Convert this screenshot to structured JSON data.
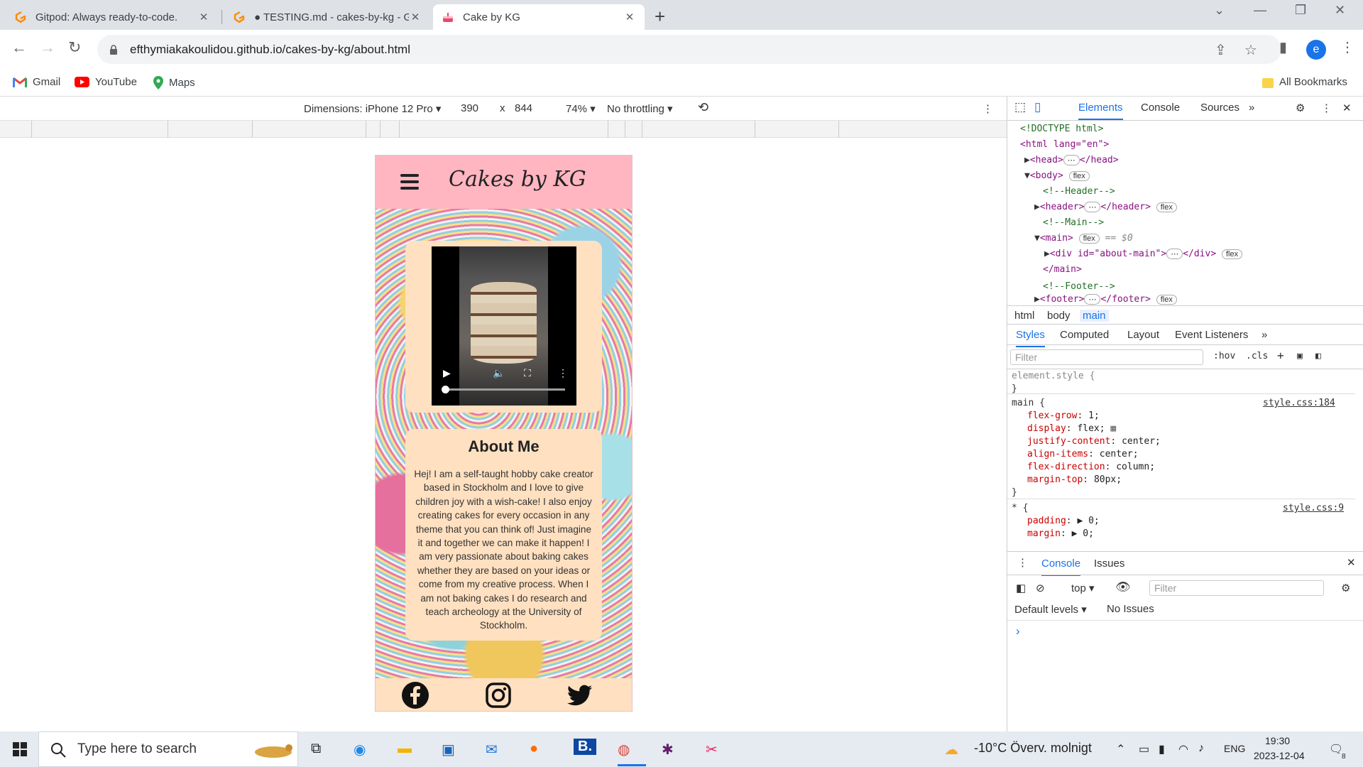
{
  "browser": {
    "tabs": [
      {
        "title": "Gitpod: Always ready-to-code.",
        "icon": "gitpod-icon"
      },
      {
        "title": "● TESTING.md - cakes-by-kg - G",
        "icon": "gitpod-icon"
      },
      {
        "title": "Cake by KG",
        "icon": "cake-favicon"
      }
    ],
    "url": "efthymiakakoulidou.github.io/cakes-by-kg/about.html",
    "profile_initial": "e",
    "bookmarks": [
      {
        "label": "Gmail",
        "icon": "gmail-icon"
      },
      {
        "label": "YouTube",
        "icon": "youtube-icon"
      },
      {
        "label": "Maps",
        "icon": "maps-icon"
      }
    ],
    "all_bookmarks": "All Bookmarks"
  },
  "device_toolbar": {
    "dimensions": "Dimensions: iPhone 12 Pro",
    "width": "390",
    "x": "x",
    "height": "844",
    "zoom": "74%",
    "throttling": "No throttling"
  },
  "site": {
    "brand": "Cakes by KG",
    "about_title": "About Me",
    "about_text": "Hej! I am a self-taught hobby cake creator based in Stockholm and I love to give children joy with a wish-cake! I also enjoy creating cakes for every occasion in any theme that you can think of! Just imagine it and together we can make it happen! I am very passionate about baking cakes whether they are based on your ideas or come from my creative process. When I am not baking cakes I do research and teach archeology at the University of Stockholm."
  },
  "devtools": {
    "tabs": [
      "Elements",
      "Console",
      "Sources"
    ],
    "dom": {
      "doctype": "<!DOCTYPE html>",
      "html_open": "<html lang=\"en\">",
      "head": "<head>",
      "head_close": "</head>",
      "body": "<body>",
      "cmt_header": "<!--Header-->",
      "header": "<header>",
      "header_close": "</header>",
      "cmt_main": "<!--Main-->",
      "main": "<main>",
      "eq": "== $0",
      "div_open": "<div id=\"about-main\">",
      "div_close": "</div>",
      "main_close": "</main>",
      "cmt_footer": "<!--Footer-->",
      "footer": "<footer>",
      "footer_close": "</footer>",
      "flex": "flex",
      "ellipsis": "⋯"
    },
    "breadcrumbs": [
      "html",
      "body",
      "main"
    ],
    "subtabs": [
      "Styles",
      "Computed",
      "Layout",
      "Event Listeners"
    ],
    "filter_placeholder": "Filter",
    "hov": ":hov",
    "cls": ".cls",
    "styles": {
      "element_style": "element.style {",
      "close": "}",
      "main_selector": "main {",
      "main_source": "style.css:184",
      "props": [
        {
          "name": "flex-grow",
          "value": "1;"
        },
        {
          "name": "display",
          "value": "flex;"
        },
        {
          "name": "justify-content",
          "value": "center;"
        },
        {
          "name": "align-items",
          "value": "center;"
        },
        {
          "name": "flex-direction",
          "value": "column;"
        },
        {
          "name": "margin-top",
          "value": "80px;"
        }
      ],
      "star_selector": "* {",
      "star_source": "style.css:9",
      "star_props": [
        {
          "name": "padding",
          "value": "▶ 0;"
        },
        {
          "name": "margin",
          "value": "▶ 0;"
        }
      ]
    },
    "console": {
      "tabs": [
        "Console",
        "Issues"
      ],
      "context": "top",
      "filter": "Filter",
      "levels": "Default levels",
      "issues": "No Issues",
      "prompt": "›"
    }
  },
  "taskbar": {
    "search_placeholder": "Type here to search",
    "weather": "-10°C  Överv. molnigt",
    "language": "ENG",
    "time": "19:30",
    "date": "2023-12-04",
    "notifications": "8"
  },
  "colors": {
    "header_pink": "#ffb6c1",
    "card_peach": "#ffe0c0",
    "devtools_blue": "#1a73e8"
  }
}
